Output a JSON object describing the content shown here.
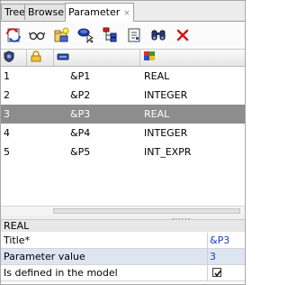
{
  "tabs": [
    {
      "label": "Tree"
    },
    {
      "label": "Browser"
    },
    {
      "label": "Parameter",
      "close": "×"
    }
  ],
  "toolbar_icons": [
    "refresh-parameters-icon",
    "glasses-view-icon",
    "new-parameter-icon",
    "select-object-icon",
    "tree-hierarchy-icon",
    "document-properties-icon",
    "binoculars-find-icon",
    "delete-icon"
  ],
  "columns": [
    {
      "icon": "shield-icon"
    },
    {
      "icon": "lock-icon"
    },
    {
      "icon": "name-tag-icon"
    },
    {
      "icon": "color-type-icon"
    }
  ],
  "rows": [
    {
      "index": "1",
      "name": "&P1",
      "type": "REAL",
      "selected": false
    },
    {
      "index": "2",
      "name": "&P2",
      "type": "INTEGER",
      "selected": false
    },
    {
      "index": "3",
      "name": "&P3",
      "type": "REAL",
      "selected": true
    },
    {
      "index": "4",
      "name": "&P4",
      "type": "INTEGER",
      "selected": false
    },
    {
      "index": "5",
      "name": "&P5",
      "type": "INT_EXPR",
      "selected": false
    }
  ],
  "splitter_grip": "......",
  "properties": {
    "title": "REAL",
    "rows": [
      {
        "label": "Title*",
        "value": "&P3"
      },
      {
        "label": "Parameter value",
        "value": "3"
      },
      {
        "label": "Is defined in the model",
        "checked": true
      }
    ]
  },
  "colors": {
    "selection": "#8d8d8d",
    "link_value": "#1a3cc8",
    "alt_row": "#dde5f2"
  }
}
